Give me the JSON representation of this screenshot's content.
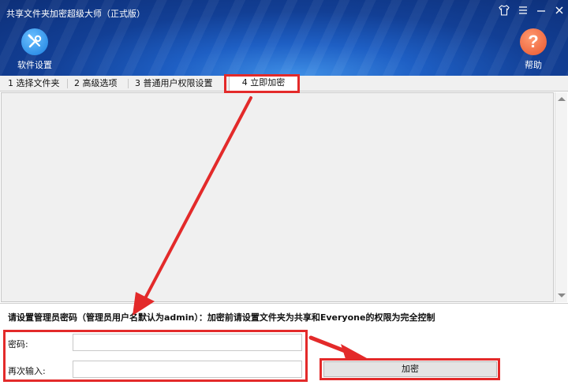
{
  "window": {
    "title": "共享文件夹加密超级大师（正式版）",
    "controls": {
      "skin_icon": "shirt-icon",
      "menu_icon": "menu-icon",
      "minimize_icon": "minimize-icon",
      "close_icon": "close-icon"
    }
  },
  "toolbar": {
    "settings": {
      "label": "软件设置",
      "icon": "wrench-screwdriver-icon"
    },
    "help": {
      "label": "帮助",
      "icon": "question-icon",
      "glyph": "?"
    }
  },
  "tabs": [
    {
      "label": "1 选择文件夹"
    },
    {
      "label": "2 高级选项"
    },
    {
      "label": "3 普通用户权限设置"
    },
    {
      "label": "4 立即加密",
      "active": true
    }
  ],
  "form": {
    "notice": "请设置管理员密码（管理员用户名默认为admin）：加密前请设置文件夹为共享和Everyone的权限为完全控制",
    "password_label": "密码:",
    "password_value": "",
    "confirm_label": "再次输入:",
    "confirm_value": "",
    "encrypt_button": "加密"
  },
  "colors": {
    "highlight": "#e32a2a",
    "title_bg": "#1a4fb0",
    "settings_icon": "#1a7fe0",
    "help_icon": "#e8552e"
  }
}
